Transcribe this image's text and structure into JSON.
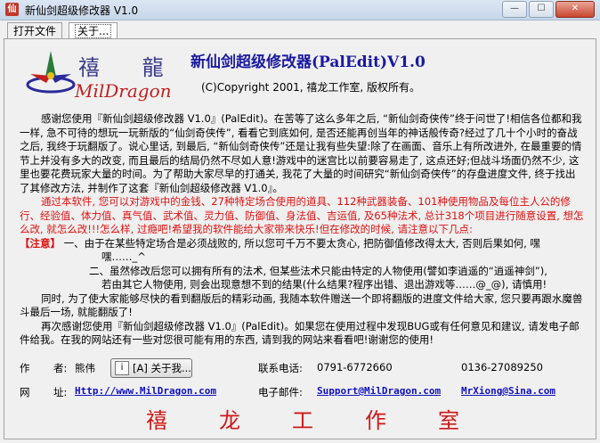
{
  "window": {
    "title": "新仙剑超级修改器 V1.0",
    "minimize": "—",
    "maximize": "☐",
    "close": "✕"
  },
  "tabs": [
    {
      "label": "打开文件"
    },
    {
      "label": "关于..."
    }
  ],
  "logo": {
    "cn_text": "禧 龍",
    "en_text": "MilDragon"
  },
  "header": {
    "title": "新仙剑超级修改器(PalEdit)V1.0",
    "copyright": "(C)Copyright 2001, 禧龙工作室, 版权所有。"
  },
  "body": {
    "para1": "感谢您使用『新仙剑超级修改器 V1.0』(PalEdit)。在苦等了这么多年之后, “新仙剑奇侠传”终于问世了!相信各位都和我一样, 急不可待的想玩一玩新版的“仙剑奇侠传”, 看看它到底如何, 是否还能再创当年的神话般传奇?经过了几十个小时的奋战之后, 我终于玩翻版了。说心里话, 到最后, “新仙剑奇侠传”还是让我有些失望:除了在画面、音乐上有所改进外, 在最重要的情节上并没有多大的改变, 而且最后的结局仍然不尽如人意!游戏中的迷宫比以前要容易走了, 这点还好;但战斗场面仍然不少, 这里也要花费玩家大量的时间。为了帮助大家尽早的打通关, 我花了大量的时间研究“新仙剑奇侠传”的存盘进度文件, 终于找出了其修改方法, 并制作了这套『新仙剑超级修改器 V1.0』。",
    "para2_red": "通过本软件, 您可以对游戏中的金钱、27种特定场合使用的道具、112种武器装备、101种使用物品及每位主人公的修行、经验值、体力值、真气值、武术值、灵力值、防御值、身法值、吉运值, 及65种法术, 总计318个项目进行随意设置, 想怎么改, 就怎么改!!!怎么样, 过瘾吧!希望我的软件能给大家带来快乐!但在修改的时候, 请注意以下几点:",
    "note_label": "【注意】",
    "note1_a": "一、由于在某些特定场合是必须战败的, 所以您可千万不要太贪心, 把防御值修改得太大, 否则后果如何, 嘿",
    "note1_b": "嘿……_^",
    "note2_a": "二、虽然修改后您可以拥有所有的法术, 但某些法术只能由特定的人物使用(譬如李逍遥的“逍遥神剑”),",
    "note2_b": "若由其它人物使用, 则会出现意想不到的结果(什么结果?程序出错、退出游戏等……@_@), 请慎用!",
    "para3": "同时, 为了使大家能够尽快的看到翻版后的精彩动画, 我随本软件赠送一个即将翻版的进度文件给大家, 您只要再跟水魔兽斗最后一场, 就能翻版了!",
    "para4": "再次感谢您使用『新仙剑超级修改器 V1.0』(PalEdit)。如果您在使用过程中发现BUG或有任何意见和建议, 请发电子邮件给我。在我的网站还有一些对您很可能有用的东西, 请到我的网站来看看吧!谢谢您的使用!"
  },
  "info": {
    "author_label": "作",
    "author_label2": "者:",
    "author_name": "熊伟",
    "about_button": "[A] 关于我...",
    "phone_label": "联系电话:",
    "phone1": "0791-6772660",
    "phone2": "0136-27089250",
    "site_label": "网",
    "site_label2": "址:",
    "site_url": "Http://www.MilDragon.com",
    "email_label": "电子邮件:",
    "email1": "Support@MilDragon.com",
    "email2": "MrXiong@Sina.com"
  },
  "footer": {
    "studio": "禧龙工作室"
  },
  "colors": {
    "title_blue": "#1a1aa0",
    "red": "#e01010",
    "link_blue": "#1010c0"
  }
}
